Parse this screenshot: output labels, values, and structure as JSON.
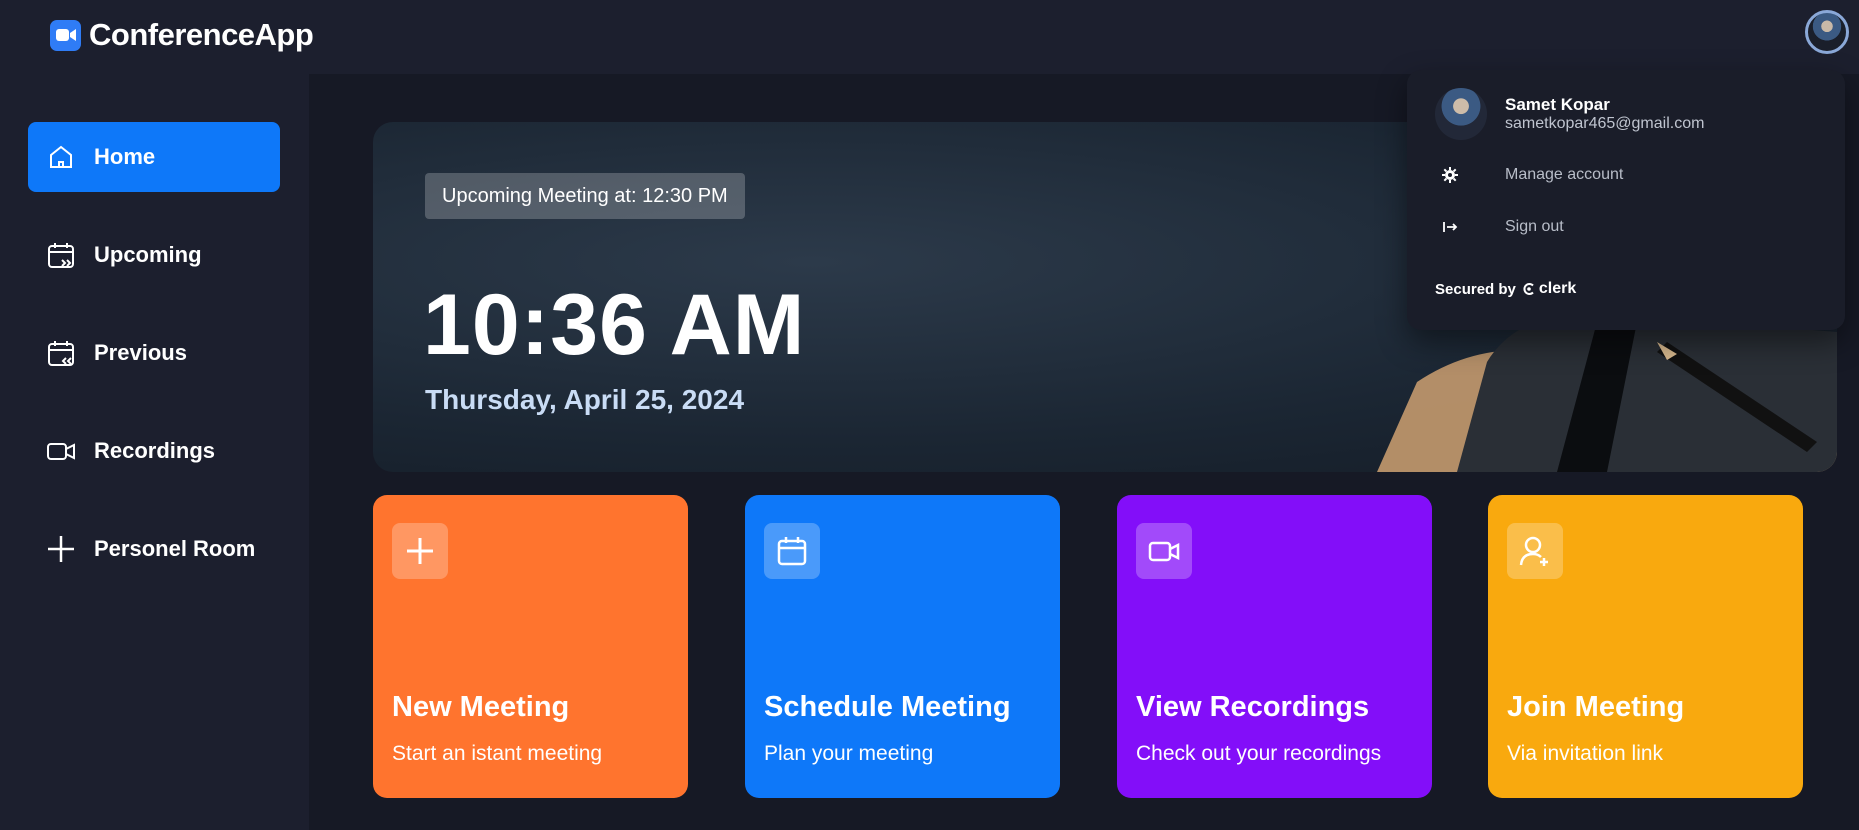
{
  "app": {
    "name": "ConferenceApp"
  },
  "sidebar": {
    "items": [
      {
        "label": "Home",
        "icon": "home-icon",
        "active": true
      },
      {
        "label": "Upcoming",
        "icon": "calendar-upcoming-icon"
      },
      {
        "label": "Previous",
        "icon": "calendar-previous-icon"
      },
      {
        "label": "Recordings",
        "icon": "video-icon"
      },
      {
        "label": "Personel Room",
        "icon": "plus-icon"
      }
    ]
  },
  "hero": {
    "badge": "Upcoming Meeting at: 12:30 PM",
    "time": "10:36 AM",
    "date": "Thursday, April 25, 2024"
  },
  "cards": [
    {
      "title": "New Meeting",
      "subtitle": "Start an istant meeting",
      "icon": "plus-icon",
      "color": "#ff742e"
    },
    {
      "title": "Schedule Meeting",
      "subtitle": "Plan your meeting",
      "icon": "calendar-icon",
      "color": "#0e78f9"
    },
    {
      "title": "View Recordings",
      "subtitle": "Check out your recordings",
      "icon": "video-icon",
      "color": "#830ef9"
    },
    {
      "title": "Join Meeting",
      "subtitle": "Via invitation link",
      "icon": "add-user-icon",
      "color": "#f9a90e"
    }
  ],
  "user_menu": {
    "name": "Samet Kopar",
    "email": "sametkopar465@gmail.com",
    "manage_label": "Manage account",
    "signout_label": "Sign out",
    "secured_label": "Secured by",
    "brand": "clerk"
  },
  "colors": {
    "accent": "#0e78f9",
    "background": "#161925",
    "panel": "#1c1f2e"
  }
}
